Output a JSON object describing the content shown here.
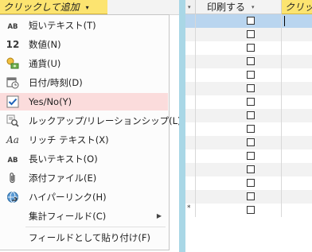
{
  "left_header": {
    "add_field_label": "クリックして追加",
    "dropdown_glyph": "▾"
  },
  "menu": {
    "items": [
      {
        "label": "短いテキスト(T)",
        "icon": "AB",
        "icon_name": "short-text-icon"
      },
      {
        "label": "数値(N)",
        "icon": "12",
        "icon_name": "number-icon"
      },
      {
        "label": "通貨(U)",
        "icon": "💱",
        "icon_name": "currency-icon"
      },
      {
        "label": "日付/時刻(D)",
        "icon": "📅",
        "icon_name": "date-time-icon"
      },
      {
        "label": "Yes/No(Y)",
        "icon": "✔",
        "icon_name": "yes-no-icon",
        "highlighted": true
      },
      {
        "label": "ルックアップ/リレーションシップ(L)",
        "icon": "🔍",
        "icon_name": "lookup-icon"
      },
      {
        "label": "リッチ テキスト(X)",
        "icon": "Aa",
        "icon_name": "rich-text-icon"
      },
      {
        "label": "長いテキスト(O)",
        "icon": "AB",
        "icon_name": "long-text-icon"
      },
      {
        "label": "添付ファイル(E)",
        "icon": "📎",
        "icon_name": "attachment-icon"
      },
      {
        "label": "ハイパーリンク(H)",
        "icon": "🔗",
        "icon_name": "hyperlink-icon"
      },
      {
        "label": "集計フィールド(C)",
        "icon": "",
        "icon_name": "",
        "submenu_arrow": "▶"
      },
      {
        "label": "フィールドとして貼り付け(F)",
        "icon": "",
        "icon_name": ""
      }
    ]
  },
  "right_table": {
    "columns": [
      "印刷する",
      "クリック"
    ],
    "header_dropdown_glyph": "▾",
    "row_count": 15,
    "new_row_marker": "*"
  },
  "colors": {
    "add_field_header": "#fce470",
    "highlight": "#fbdcdc",
    "divider": "#a9d7e6",
    "selected_row": "#b9d5ef"
  }
}
